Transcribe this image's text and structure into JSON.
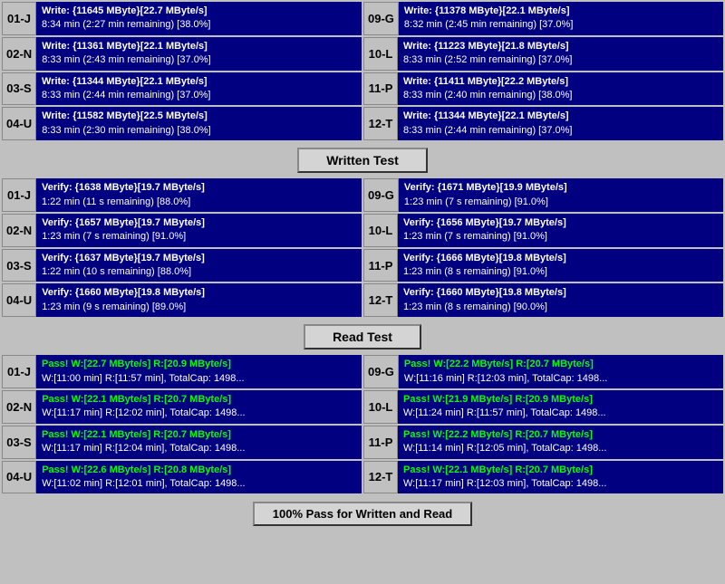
{
  "write_section": {
    "header": "Written Test",
    "rows": [
      {
        "left": {
          "id": "01-J",
          "line1": "Write: {11645 MByte}[22.7 MByte/s]",
          "line2": "8:34 min (2:27 min remaining)  [38.0%]"
        },
        "right": {
          "id": "09-G",
          "line1": "Write: {11378 MByte}[22.1 MByte/s]",
          "line2": "8:32 min (2:45 min remaining)  [37.0%]"
        }
      },
      {
        "left": {
          "id": "02-N",
          "line1": "Write: {11361 MByte}[22.1 MByte/s]",
          "line2": "8:33 min (2:43 min remaining)  [37.0%]"
        },
        "right": {
          "id": "10-L",
          "line1": "Write: {11223 MByte}[21.8 MByte/s]",
          "line2": "8:33 min (2:52 min remaining)  [37.0%]"
        }
      },
      {
        "left": {
          "id": "03-S",
          "line1": "Write: {11344 MByte}[22.1 MByte/s]",
          "line2": "8:33 min (2:44 min remaining)  [37.0%]"
        },
        "right": {
          "id": "11-P",
          "line1": "Write: {11411 MByte}[22.2 MByte/s]",
          "line2": "8:33 min (2:40 min remaining)  [38.0%]"
        }
      },
      {
        "left": {
          "id": "04-U",
          "line1": "Write: {11582 MByte}[22.5 MByte/s]",
          "line2": "8:33 min (2:30 min remaining)  [38.0%]"
        },
        "right": {
          "id": "12-T",
          "line1": "Write: {11344 MByte}[22.1 MByte/s]",
          "line2": "8:33 min (2:44 min remaining)  [37.0%]"
        }
      }
    ]
  },
  "verify_section": {
    "header": "Written Test",
    "rows": [
      {
        "left": {
          "id": "01-J",
          "line1": "Verify: {1638 MByte}[19.7 MByte/s]",
          "line2": "1:22 min (11 s remaining)  [88.0%]"
        },
        "right": {
          "id": "09-G",
          "line1": "Verify: {1671 MByte}[19.9 MByte/s]",
          "line2": "1:23 min (7 s remaining)  [91.0%]"
        }
      },
      {
        "left": {
          "id": "02-N",
          "line1": "Verify: {1657 MByte}[19.7 MByte/s]",
          "line2": "1:23 min (7 s remaining)  [91.0%]"
        },
        "right": {
          "id": "10-L",
          "line1": "Verify: {1656 MByte}[19.7 MByte/s]",
          "line2": "1:23 min (7 s remaining)  [91.0%]"
        }
      },
      {
        "left": {
          "id": "03-S",
          "line1": "Verify: {1637 MByte}[19.7 MByte/s]",
          "line2": "1:22 min (10 s remaining)  [88.0%]"
        },
        "right": {
          "id": "11-P",
          "line1": "Verify: {1666 MByte}[19.8 MByte/s]",
          "line2": "1:23 min (8 s remaining)  [91.0%]"
        }
      },
      {
        "left": {
          "id": "04-U",
          "line1": "Verify: {1660 MByte}[19.8 MByte/s]",
          "line2": "1:23 min (9 s remaining)  [89.0%]"
        },
        "right": {
          "id": "12-T",
          "line1": "Verify: {1660 MByte}[19.8 MByte/s]",
          "line2": "1:23 min (8 s remaining)  [90.0%]"
        }
      }
    ]
  },
  "read_section": {
    "header": "Read Test",
    "rows": [
      {
        "left": {
          "id": "01-J",
          "line1": "Pass! W:[22.7 MByte/s] R:[20.9 MByte/s]",
          "line2": "W:[11:00 min] R:[11:57 min], TotalCap: 1498..."
        },
        "right": {
          "id": "09-G",
          "line1": "Pass! W:[22.2 MByte/s] R:[20.7 MByte/s]",
          "line2": "W:[11:16 min] R:[12:03 min], TotalCap: 1498..."
        }
      },
      {
        "left": {
          "id": "02-N",
          "line1": "Pass! W:[22.1 MByte/s] R:[20.7 MByte/s]",
          "line2": "W:[11:17 min] R:[12:02 min], TotalCap: 1498..."
        },
        "right": {
          "id": "10-L",
          "line1": "Pass! W:[21.9 MByte/s] R:[20.9 MByte/s]",
          "line2": "W:[11:24 min] R:[11:57 min], TotalCap: 1498..."
        }
      },
      {
        "left": {
          "id": "03-S",
          "line1": "Pass! W:[22.1 MByte/s] R:[20.7 MByte/s]",
          "line2": "W:[11:17 min] R:[12:04 min], TotalCap: 1498..."
        },
        "right": {
          "id": "11-P",
          "line1": "Pass! W:[22.2 MByte/s] R:[20.7 MByte/s]",
          "line2": "W:[11:14 min] R:[12:05 min], TotalCap: 1498..."
        }
      },
      {
        "left": {
          "id": "04-U",
          "line1": "Pass! W:[22.6 MByte/s] R:[20.8 MByte/s]",
          "line2": "W:[11:02 min] R:[12:01 min], TotalCap: 1498..."
        },
        "right": {
          "id": "12-T",
          "line1": "Pass! W:[22.1 MByte/s] R:[20.7 MByte/s]",
          "line2": "W:[11:17 min] R:[12:03 min], TotalCap: 1498..."
        }
      }
    ]
  },
  "status": {
    "label": "100% Pass for Written and Read"
  }
}
